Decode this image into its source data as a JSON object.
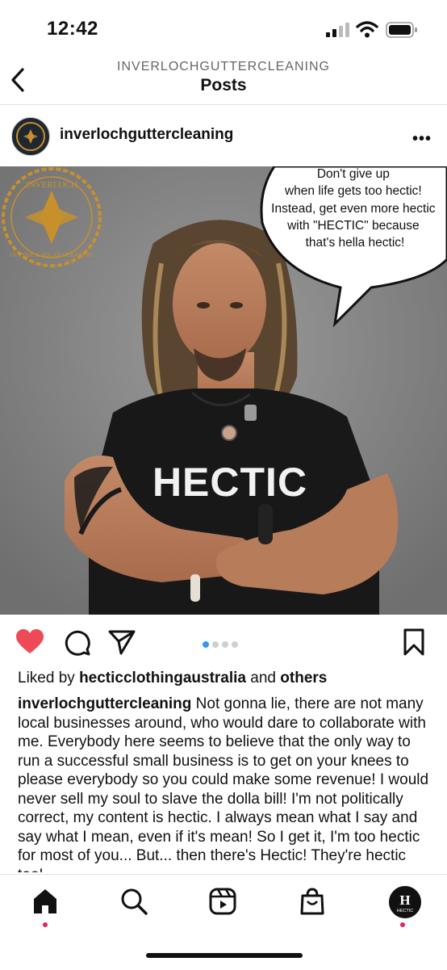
{
  "status_bar": {
    "time": "12:42"
  },
  "header": {
    "account": "INVERLOCHGUTTERCLEANING",
    "title": "Posts"
  },
  "post": {
    "username": "inverlochguttercleaning",
    "image": {
      "logo_text_top": "INVERLOCH",
      "logo_text_bottom": "GUTTER & SOLAR CLEANING",
      "speech_lines": [
        "Don't give up",
        "when life gets too hectic!",
        "Instead, get even more hectic",
        "with \"HECTIC\" because",
        "that's hella hectic!"
      ],
      "shirt_text": "HECTIC"
    },
    "carousel": {
      "count": 4,
      "active_index": 0
    },
    "likes": {
      "prefix": "Liked by",
      "user": "hecticclothingaustralia",
      "joiner": "and",
      "others": "others"
    },
    "caption": {
      "user": "inverlochguttercleaning",
      "text": "Not gonna lie, there are not many local businesses around, who would dare to collaborate with me. Everybody here seems to believe that the only way to run a successful small business is to get on your knees to please everybody so you could make some revenue! I would never sell my soul to slave the dolla bill! I'm not politically correct, my content is hectic. I always mean what I say and say what I mean, even if it's mean! So I get it, I'm too hectic for most of you... But... then there's Hectic! They're hectic too!"
    }
  },
  "tabbar": {
    "items": [
      "home",
      "search",
      "reels",
      "shop",
      "profile"
    ],
    "profile_avatar_text": "HECTIC"
  },
  "colors": {
    "like": "#ed4956",
    "carousel_active": "#3897f0",
    "notification": "#e0245e",
    "logo_gold": "#c8902c"
  }
}
